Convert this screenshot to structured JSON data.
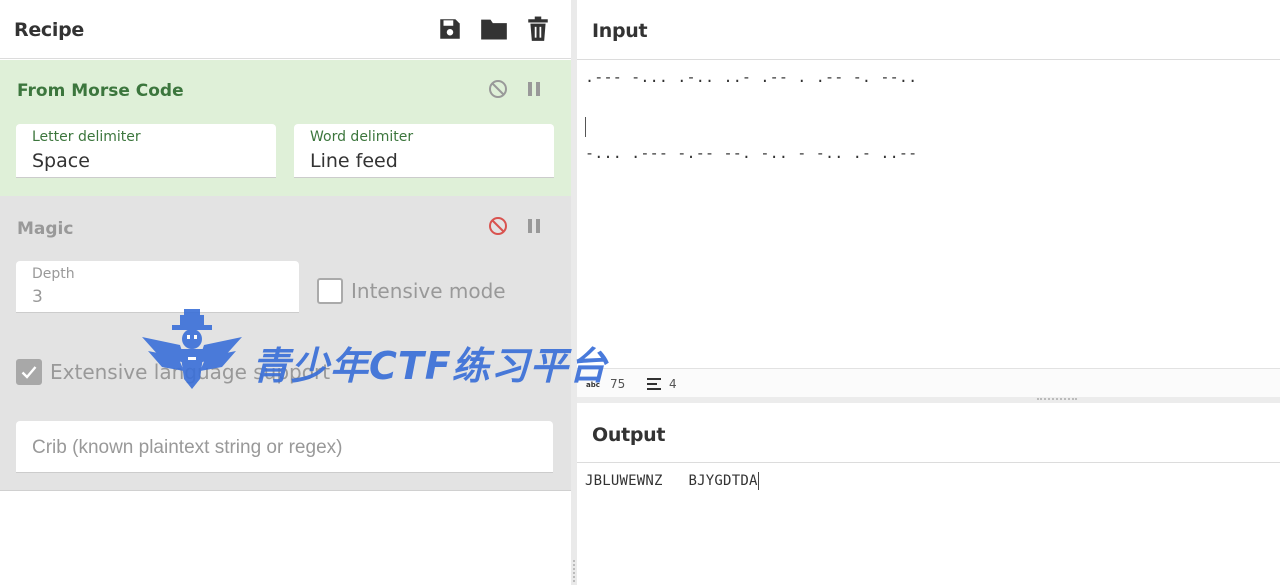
{
  "recipe": {
    "title": "Recipe",
    "icons": [
      "save-icon",
      "folder-icon",
      "trash-icon"
    ]
  },
  "operations": [
    {
      "name": "From Morse Code",
      "letter_delimiter_label": "Letter delimiter",
      "letter_delimiter_value": "Space",
      "word_delimiter_label": "Word delimiter",
      "word_delimiter_value": "Line feed"
    },
    {
      "name": "Magic",
      "depth_label": "Depth",
      "depth_value": "3",
      "intensive_label": "Intensive mode",
      "intensive_checked": false,
      "extensive_label": "Extensive language support",
      "extensive_checked": true,
      "crib_placeholder": "Crib (known plaintext string or regex)"
    }
  ],
  "input": {
    "title": "Input",
    "line1": ".--- -... .-.. ..- .-- . .-- -. --..",
    "line3": "-... .--- -.-- --. -.. - -.. .- ..--",
    "length": "75",
    "lines": "4"
  },
  "output": {
    "title": "Output",
    "text": "JBLUWEWNZ   BJYGDTDA"
  },
  "watermark": {
    "text": "青少年CTF练习平台"
  },
  "colors": {
    "morse_bg": "#dff0d8",
    "morse_title": "#3c763d",
    "magic_bg": "#e3e3e3",
    "disable_active": "#d9534f",
    "watermark": "#3a6fd8"
  }
}
